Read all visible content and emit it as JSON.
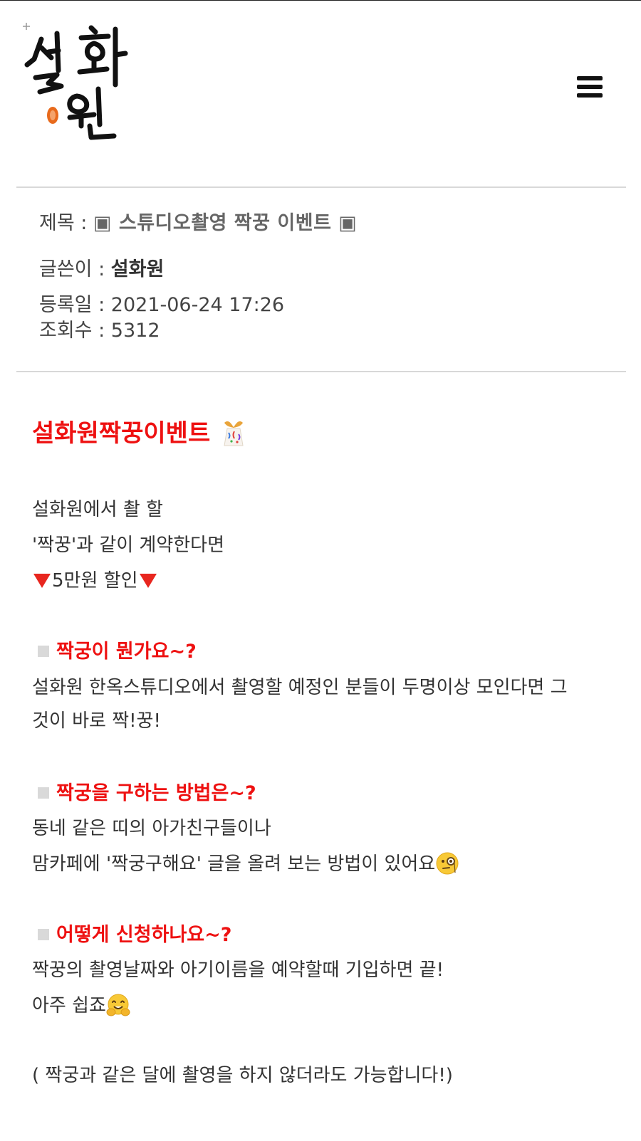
{
  "header": {
    "logo_text": "설화원",
    "menu_icon": "hamburger-menu-icon"
  },
  "post_meta": {
    "title_label": "제목 :",
    "title_value": "▣ 스튜디오촬영 짝꿍 이벤트 ▣",
    "author_label": "글쓴이 :",
    "author_value": "설화원",
    "date_label": "등록일 :",
    "date_value": "2021-06-24 17:26",
    "views_label": "조회수 :",
    "views_value": "5312"
  },
  "content": {
    "event_title": "설화원짝꿍이벤트",
    "event_title_icon": "party-popper-icon",
    "intro": [
      "설화원에서 촬 할",
      "'짝꿍'과 같이 계약한다면",
      "5만원 할인"
    ],
    "q1": {
      "question": "짝궁이 뭔가요~?",
      "answer_line1": "설화원 한옥스튜디오에서 촬영할 예정인 분들이 두명이상 모인다면 그",
      "answer_line2": "것이 바로 짝!꿍!"
    },
    "q2": {
      "question": "짝궁을 구하는 방법은~?",
      "answer_line1": "동네 같은 띠의 아가친구들이나",
      "answer_line2": "맘카페에 '짝궁구해요' 글을 올려 보는 방법이 있어요"
    },
    "q3": {
      "question": "어떻게 신청하나요~?",
      "answer_line1": "짝꿍의 촬영날짜와 아기이름을 예약할때 기입하면 끝!",
      "answer_line2": "아주 쉽죠"
    },
    "note": "( 짝궁과 같은 달에 촬영을 하지 않더라도 가능합니다!)"
  },
  "colors": {
    "accent_red": "#ee1111",
    "divider": "#d8d8d8"
  }
}
